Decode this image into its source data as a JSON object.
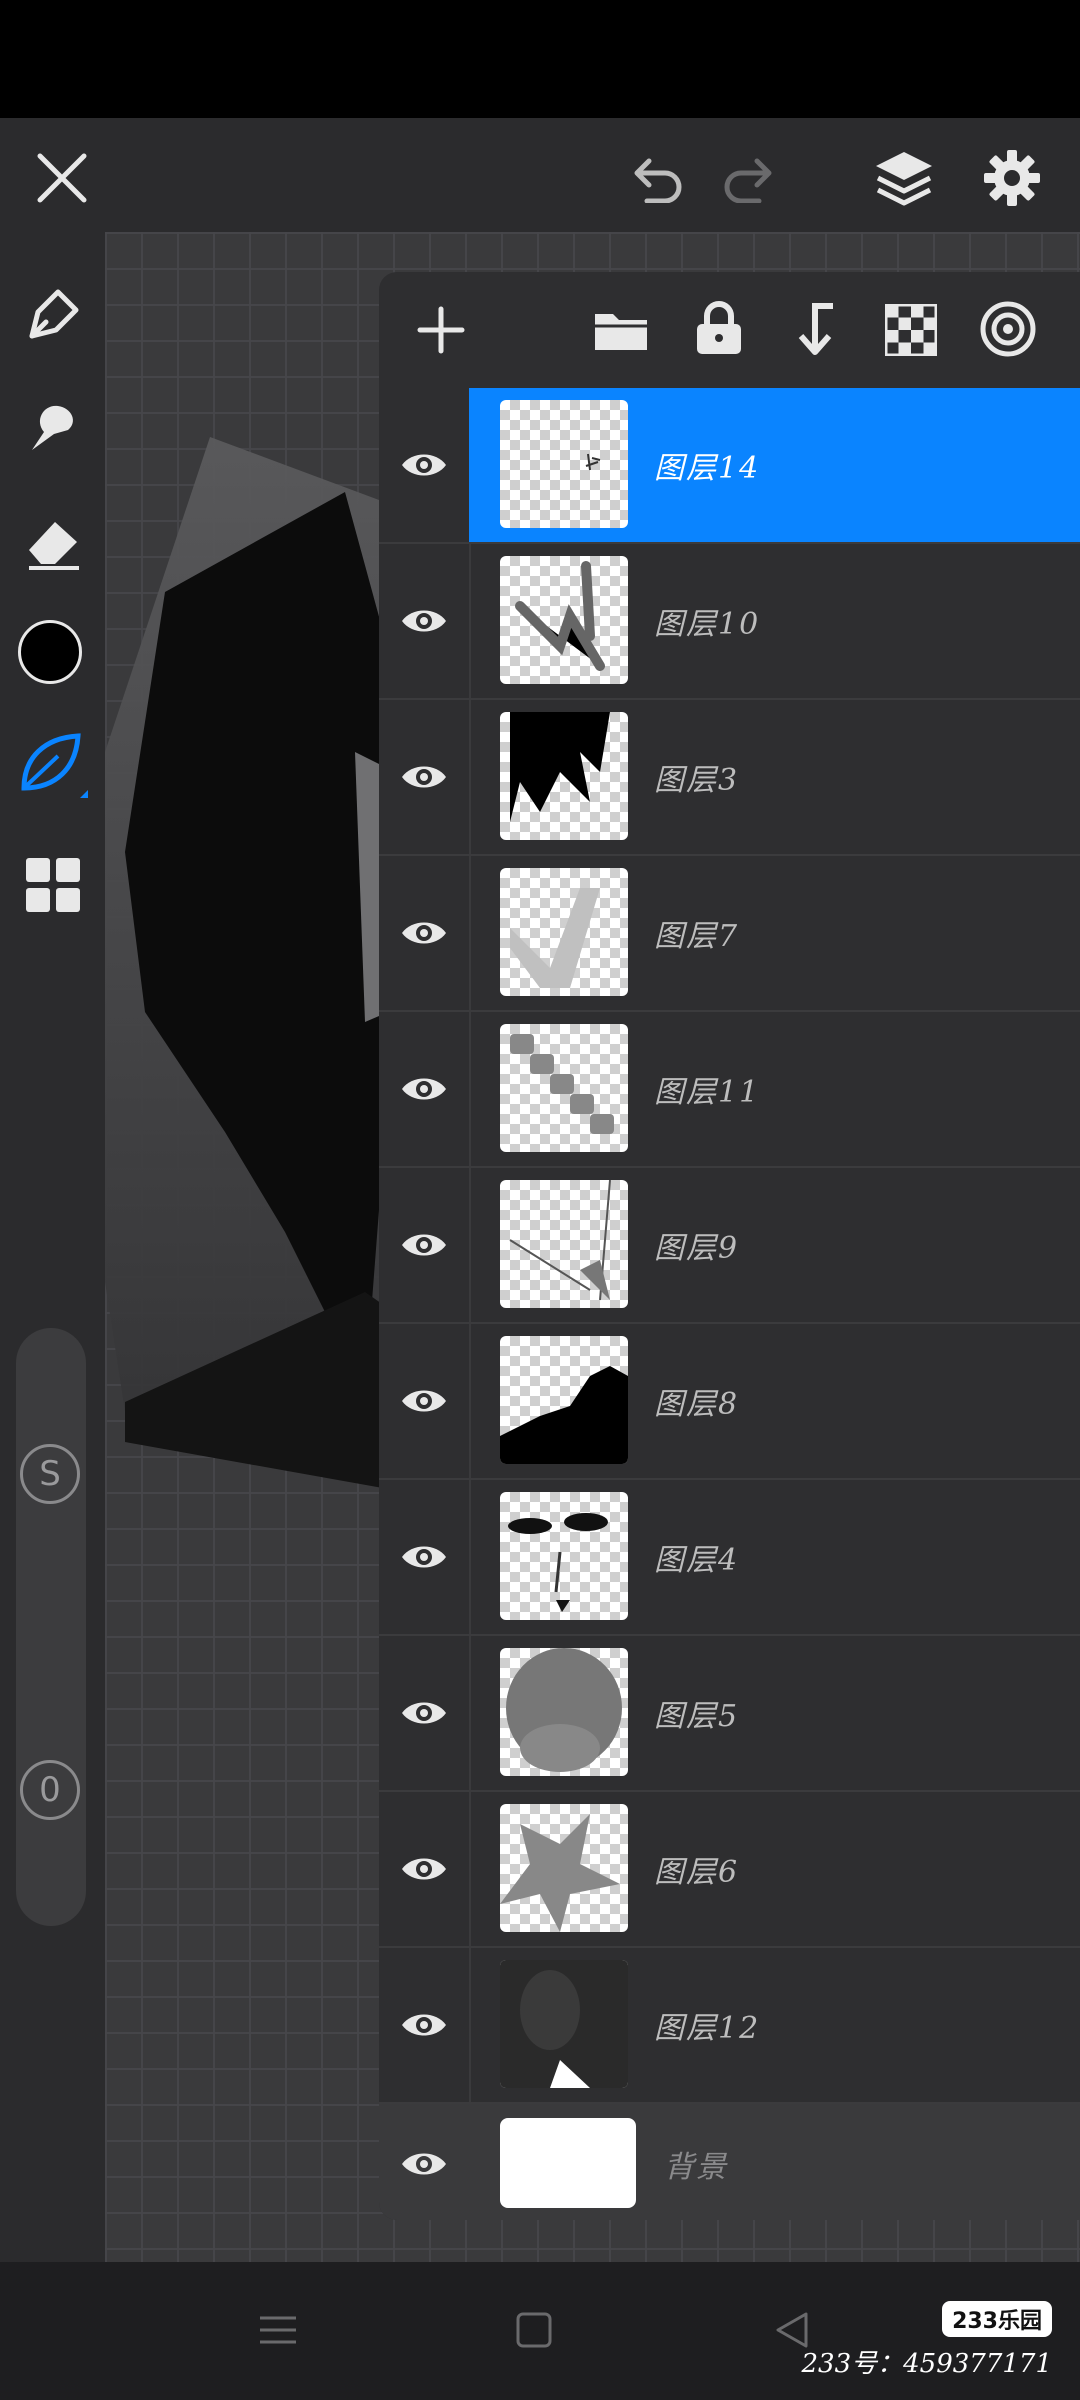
{
  "toolbar": {
    "close_icon": "close-icon",
    "undo_icon": "undo-icon",
    "redo_icon": "redo-icon",
    "layers_icon": "layers-icon",
    "settings_icon": "gear-icon"
  },
  "tools": [
    "pen-icon",
    "smudge-icon",
    "eraser-icon",
    "color-swatch",
    "blend-brush-icon",
    "gallery-grid-icon"
  ],
  "colors": {
    "accent": "#0a84ff",
    "current_color": "#000000"
  },
  "sliders": {
    "size_label": "S",
    "opacity_label": "0"
  },
  "layers_panel": {
    "actions": [
      "add-icon",
      "folder-icon",
      "lock-icon",
      "merge-down-icon",
      "transparency-icon",
      "target-icon"
    ],
    "layers": [
      {
        "name": "图层14",
        "visible": true,
        "selected": true
      },
      {
        "name": "图层10",
        "visible": true,
        "selected": false
      },
      {
        "name": "图层3",
        "visible": true,
        "selected": false
      },
      {
        "name": "图层7",
        "visible": true,
        "selected": false
      },
      {
        "name": "图层11",
        "visible": true,
        "selected": false
      },
      {
        "name": "图层9",
        "visible": true,
        "selected": false
      },
      {
        "name": "图层8",
        "visible": true,
        "selected": false
      },
      {
        "name": "图层4",
        "visible": true,
        "selected": false
      },
      {
        "name": "图层5",
        "visible": true,
        "selected": false
      },
      {
        "name": "图层6",
        "visible": true,
        "selected": false
      },
      {
        "name": "图层12",
        "visible": true,
        "selected": false
      }
    ],
    "background_layer": {
      "name": "背景",
      "visible": true
    }
  },
  "navbar": {
    "menu_icon": "menu-icon",
    "home_icon": "home-icon",
    "back_icon": "back-icon"
  },
  "watermark": {
    "logo": "233乐园",
    "text": "233号：459377171"
  }
}
